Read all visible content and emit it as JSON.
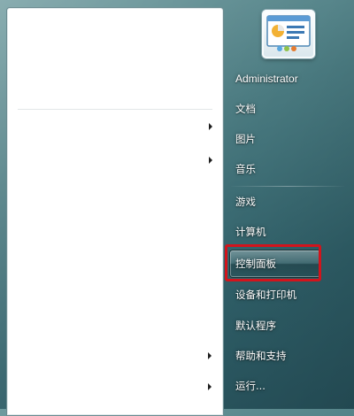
{
  "start_menu": {
    "user_name": "Administrator",
    "items": [
      {
        "label": "文档"
      },
      {
        "label": "图片"
      },
      {
        "label": "音乐"
      },
      {
        "label": "游戏"
      },
      {
        "label": "计算机"
      },
      {
        "label": "控制面板"
      },
      {
        "label": "设备和打印机"
      },
      {
        "label": "默认程序"
      },
      {
        "label": "帮助和支持"
      },
      {
        "label": "运行..."
      }
    ]
  },
  "colors": {
    "highlight_box": "#d2141c",
    "menu_background": "#4a7a80"
  },
  "icons": {
    "user_picture": "control-panel-window-icon",
    "submenu": "chevron-right-icon"
  }
}
